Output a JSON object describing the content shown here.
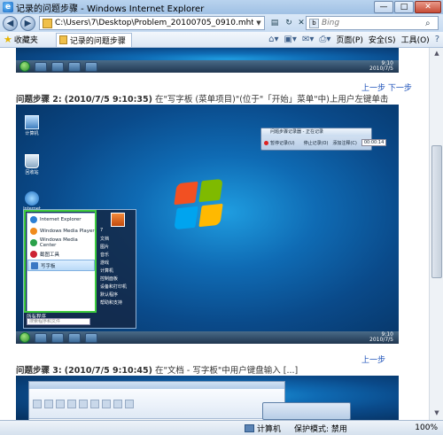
{
  "window": {
    "title": "记录的问题步骤 - Windows Internet Explorer"
  },
  "address": {
    "url": "C:\\Users\\7\\Desktop\\Problem_20100705_0910.mht",
    "search_placeholder": "Bing"
  },
  "commandbar": {
    "favorites_label": "收藏夹",
    "tab_title": "记录的问题步骤",
    "page_label": "页面(P)",
    "safety_label": "安全(S)",
    "tools_label": "工具(O)",
    "help_label": "?"
  },
  "content": {
    "nav_top": "上一步 下一步",
    "step2": {
      "label": "问题步骤 2:",
      "time": "(2010/7/5 9:10:35)",
      "text": "在\"写字板 (菜单项目)\"(位于\"「开始」菜单\"中)上用户左键单击"
    },
    "nav_mid": "上一步",
    "step3": {
      "label": "问题步骤 3:",
      "time": "(2010/7/5 9:10:45)",
      "text": "在\"文档 - 写字板\"中用户键盘输入 [...]"
    }
  },
  "screenshot2": {
    "desktop_icons": [
      "计算机",
      "回收站",
      "Internet Explorer"
    ],
    "start_menu_left": [
      "Internet Explorer",
      "Windows Media Player",
      "Windows Media Center",
      "截图工具",
      "写字板"
    ],
    "start_menu_all_programs": "所有程序",
    "start_menu_search": "搜索程序和文件",
    "start_menu_right": [
      "7",
      "文档",
      "图片",
      "音乐",
      "游戏",
      "计算机",
      "控制面板",
      "设备和打印机",
      "默认程序",
      "帮助和支持"
    ],
    "recorder_title": "问题步骤记录器 - 正在记录",
    "recorder_pause": "暂停记录(U)",
    "recorder_stop": "停止记录(O)",
    "recorder_comment": "添加注释(C)",
    "recorder_time": "00:00:14",
    "tray_time": "9:10",
    "tray_date": "2010/7/5"
  },
  "statusbar": {
    "zone": "计算机",
    "protected_mode": "保护模式: 禁用",
    "zoom": "100%"
  },
  "colors": {
    "link": "#1a4fb8",
    "highlight_border": "#3fcc3f",
    "recorder_dot": "#dd2222"
  }
}
